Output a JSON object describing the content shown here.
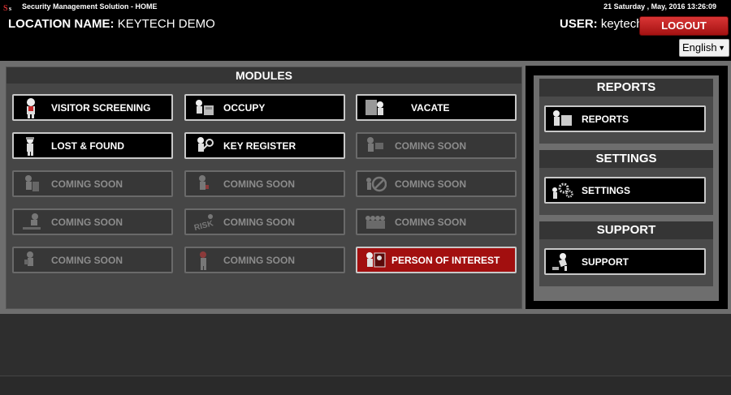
{
  "titlebar": {
    "app_title": "Security Management Solution - HOME",
    "clock": "21 Saturday , May, 2016 13:26:09",
    "icon": "app-logo-icon"
  },
  "header": {
    "location_label": "LOCATION NAME:",
    "location_value": "KEYTECH DEMO",
    "user_label": "USER:",
    "user_value": "keytech",
    "logout_label": "LOGOUT",
    "language": "English"
  },
  "modules": {
    "title": "MODULES",
    "items": [
      {
        "label": "VISITOR SCREENING",
        "state": "active",
        "icon": "visitor-figure-icon"
      },
      {
        "label": "OCCUPY",
        "state": "active",
        "icon": "occupy-figure-icon"
      },
      {
        "label": "VACATE",
        "state": "active",
        "icon": "vacate-figure-icon"
      },
      {
        "label": "LOST & FOUND",
        "state": "active",
        "icon": "lost-found-figure-icon"
      },
      {
        "label": "KEY REGISTER",
        "state": "active",
        "icon": "key-figure-icon"
      },
      {
        "label": "COMING SOON",
        "state": "disabled",
        "icon": "placeholder-figure-icon"
      },
      {
        "label": "COMING SOON",
        "state": "disabled",
        "icon": "placeholder-figure-icon"
      },
      {
        "label": "COMING SOON",
        "state": "disabled",
        "icon": "placeholder-figure-icon"
      },
      {
        "label": "COMING SOON",
        "state": "disabled",
        "icon": "no-entry-figure-icon"
      },
      {
        "label": "COMING SOON",
        "state": "disabled",
        "icon": "placeholder-figure-icon"
      },
      {
        "label": "COMING SOON",
        "state": "disabled",
        "icon": "risk-figure-icon"
      },
      {
        "label": "COMING SOON",
        "state": "disabled",
        "icon": "crowd-figure-icon"
      },
      {
        "label": "COMING SOON",
        "state": "disabled",
        "icon": "placeholder-figure-icon"
      },
      {
        "label": "COMING SOON",
        "state": "disabled",
        "icon": "placeholder-figure-icon"
      },
      {
        "label": "PERSON OF INTEREST",
        "state": "highlight",
        "icon": "person-of-interest-icon"
      }
    ]
  },
  "side": {
    "reports_title": "REPORTS",
    "reports_button": "REPORTS",
    "settings_title": "SETTINGS",
    "settings_button": "SETTINGS",
    "support_title": "SUPPORT",
    "support_button": "SUPPORT"
  },
  "colors": {
    "accent_red": "#a20f0f",
    "logout_red": "#c62828",
    "panel_gray": "#6e6e6e"
  }
}
